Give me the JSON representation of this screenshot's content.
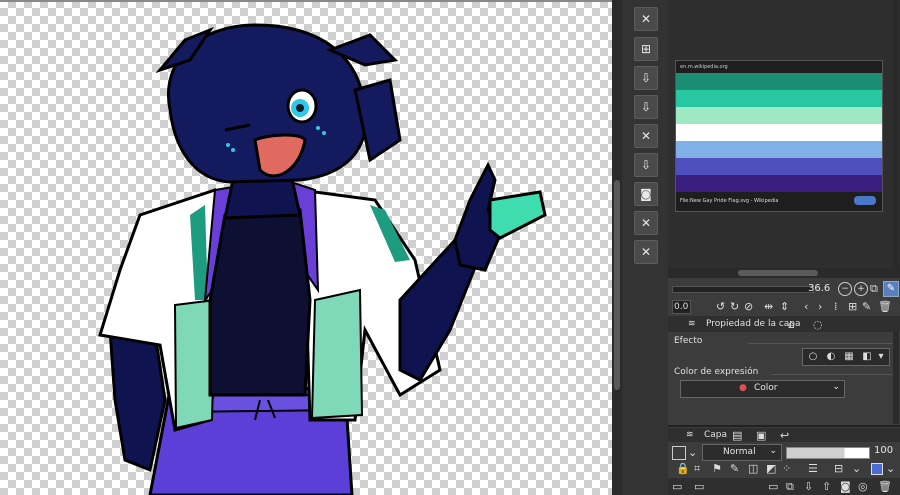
{
  "navigator": {
    "thumbnail_url": "en.m.wikipedia.org",
    "thumbnail_caption": "File:New Gay Pride Flag.svg - Wikipedia",
    "flag_colors": [
      "#1a8d72",
      "#27c7a2",
      "#9ee9c4",
      "#ffffff",
      "#7fb0e6",
      "#4f4fc0",
      "#3b1f80"
    ]
  },
  "zoom": {
    "value": "36.6"
  },
  "rotation": {
    "value": "0.0"
  },
  "layer_property": {
    "tab_label": "Propiedad de la capa",
    "effect_label": "Efecto",
    "expression_label": "Color de expresión",
    "expression_value": "Color"
  },
  "layer": {
    "tab_label": "Capa",
    "blend_mode": "Normal",
    "opacity": "100"
  },
  "icons": {
    "tool_icons": [
      "close-x-icon",
      "template-icon",
      "import-icon",
      "import-icon",
      "close-x-icon",
      "import-icon",
      "camera-icon",
      "close-x-icon",
      "close-x-icon"
    ]
  }
}
